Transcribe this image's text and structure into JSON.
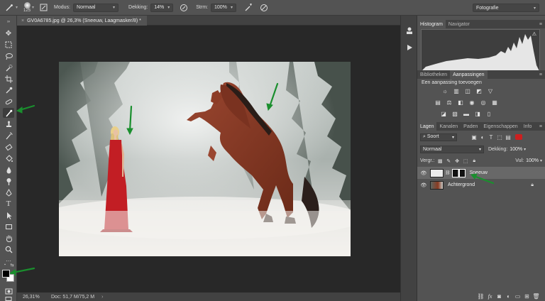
{
  "options_bar": {
    "brush_size": "125",
    "mode_label": "Modus:",
    "mode_value": "Normaal",
    "opacity_label": "Dekking:",
    "opacity_value": "14%",
    "flow_label": "Strm:",
    "flow_value": "100%",
    "workspace": "Fotografie"
  },
  "document": {
    "tab_title": "GV0A6785.jpg @ 26,3% (Sneeuw, Laagmasker/8) *",
    "tab_close": "×",
    "zoom": "26,31%",
    "doc_info": "Doc: 51,7 M/75,2 M",
    "status_arrow": "›"
  },
  "panels": {
    "histogram_tabs": [
      "Histogram",
      "Navigator"
    ],
    "adjust_tabs": [
      "Bibliotheken",
      "Aanpassingen"
    ],
    "adjust_title": "Een aanpassing toevoegen",
    "layers_tabs": [
      "Lagen",
      "Kanalen",
      "Paden",
      "Eigenschappen",
      "Info"
    ],
    "filter_label": "Soort",
    "blend_mode": "Normaal",
    "opacity_label": "Dekking:",
    "opacity_value": "100%",
    "lock_label": "Vergr.:",
    "fill_label": "Vul:",
    "fill_value": "100%",
    "menu_glyph": "≡"
  },
  "layers": [
    {
      "name": "Sneeuw",
      "selected": true
    },
    {
      "name": "Achtergrond",
      "selected": false
    }
  ],
  "colors": {
    "annotation_arrow": "#1a8f2e",
    "dress_red": "#c21e24",
    "horse_brown": "#8a3b22"
  }
}
